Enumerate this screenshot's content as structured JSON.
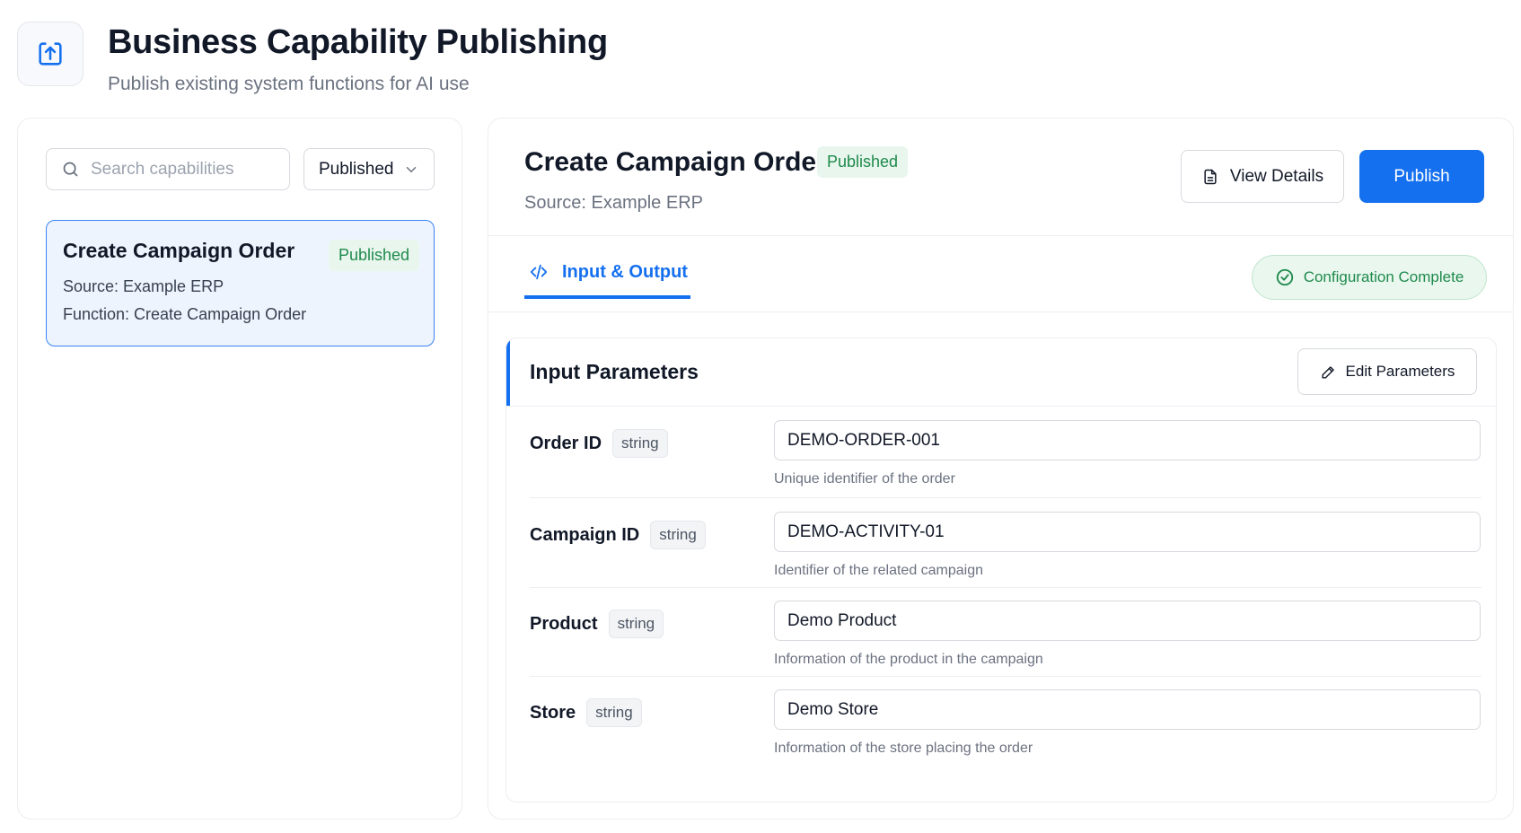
{
  "header": {
    "title": "Business Capability Publishing",
    "subtitle": "Publish existing system functions for AI use",
    "icon": "upload-icon"
  },
  "sidebar": {
    "search": {
      "placeholder": "Search capabilities",
      "value": ""
    },
    "filter": {
      "selected": "Published"
    },
    "items": [
      {
        "name": "Create Campaign Order",
        "status": "Published",
        "source": "Source: Example ERP",
        "function": "Function: Create Campaign Order"
      }
    ]
  },
  "detail": {
    "title": "Create Campaign Order",
    "status": "Published",
    "source": "Source: Example ERP",
    "view_details_label": "View Details",
    "publish_label": "Publish",
    "tab_label": "Input & Output",
    "config_status": "Configuration Complete"
  },
  "params": {
    "title": "Input Parameters",
    "edit_label": "Edit Parameters",
    "rows": [
      {
        "name": "Order ID",
        "type": "string",
        "value": "DEMO-ORDER-001",
        "description": "Unique identifier of the order"
      },
      {
        "name": "Campaign ID",
        "type": "string",
        "value": "DEMO-ACTIVITY-01",
        "description": "Identifier of the related campaign"
      },
      {
        "name": "Product",
        "type": "string",
        "value": "Demo Product",
        "description": "Information of the product in the campaign"
      },
      {
        "name": "Store",
        "type": "string",
        "value": "Demo Store",
        "description": "Information of the store placing the order"
      }
    ]
  },
  "colors": {
    "accent": "#1570ef",
    "success": "#1f8a4c",
    "success_bg": "#e8f6ee",
    "selected_bg": "#eef4fd"
  }
}
